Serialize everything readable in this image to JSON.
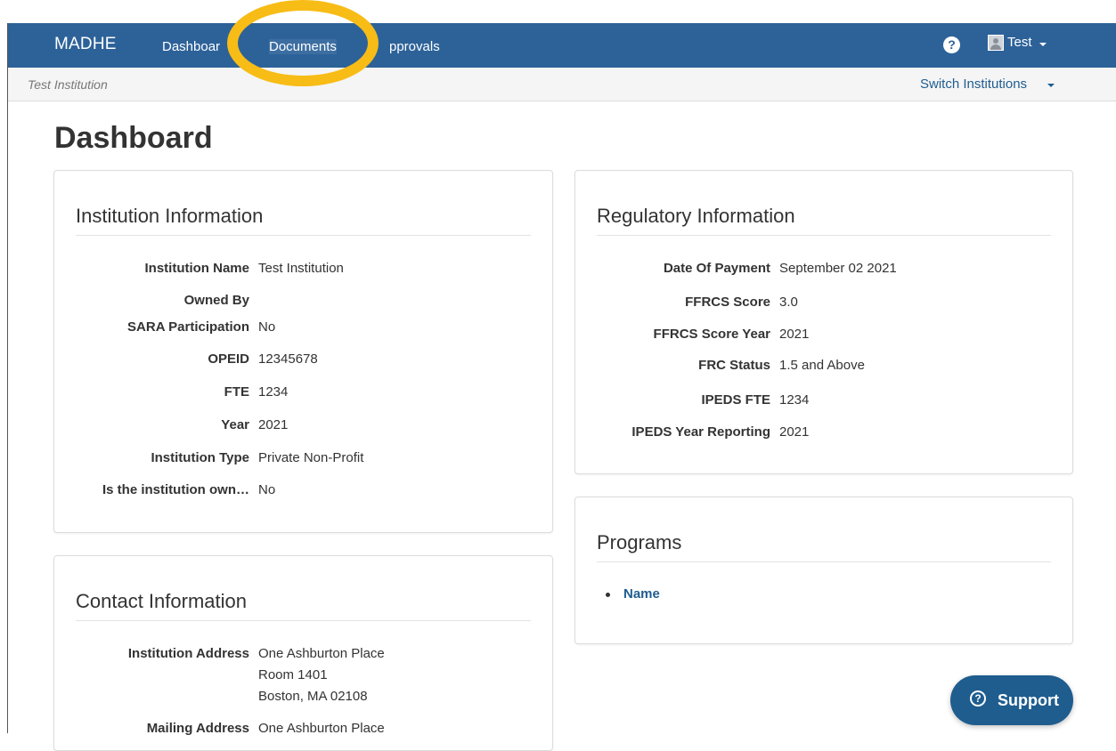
{
  "nav": {
    "brand": "MADHE",
    "items": [
      {
        "label": "Dashboar"
      },
      {
        "label": "Documents"
      },
      {
        "label": "pprovals"
      }
    ],
    "help_glyph": "?",
    "user": "Test"
  },
  "subbar": {
    "institution": "Test Institution",
    "switch_label": "Switch Institutions"
  },
  "page": {
    "title": "Dashboard"
  },
  "institution_info": {
    "title": "Institution Information",
    "rows": [
      {
        "label": "Institution Name",
        "value": "Test Institution"
      },
      {
        "label": "Owned By",
        "value": ""
      },
      {
        "label": "SARA Participation",
        "value": "No"
      },
      {
        "label": "OPEID",
        "value": "12345678"
      },
      {
        "label": "FTE",
        "value": "1234"
      },
      {
        "label": "Year",
        "value": "2021"
      },
      {
        "label": "Institution Type",
        "value": "Private Non-Profit"
      },
      {
        "label": "Is the institution own…",
        "value": "No"
      }
    ]
  },
  "regulatory_info": {
    "title": "Regulatory Information",
    "rows": [
      {
        "label": "Date Of Payment",
        "value": "September 02 2021"
      },
      {
        "label": "FFRCS Score",
        "value": "3.0"
      },
      {
        "label": "FFRCS Score Year",
        "value": "2021"
      },
      {
        "label": "FRC Status",
        "value": "1.5 and Above"
      },
      {
        "label": "IPEDS FTE",
        "value": "1234"
      },
      {
        "label": "IPEDS Year Reporting",
        "value": "2021"
      }
    ]
  },
  "programs": {
    "title": "Programs",
    "items": [
      "Name"
    ]
  },
  "contact_info": {
    "title": "Contact Information",
    "institution_address_label": "Institution Address",
    "institution_address_lines": [
      "One Ashburton Place",
      "Room 1401",
      "Boston, MA 02108"
    ],
    "mailing_address_label": "Mailing Address",
    "mailing_address_line": "One Ashburton Place"
  },
  "support": {
    "label": "Support",
    "icon_glyph": "?"
  },
  "annotation": {
    "color": "#f7bc16",
    "target": "Documents"
  },
  "colors": {
    "navbar": "#2d6299",
    "link": "#1f5d8f",
    "support": "#1f5d8f"
  }
}
